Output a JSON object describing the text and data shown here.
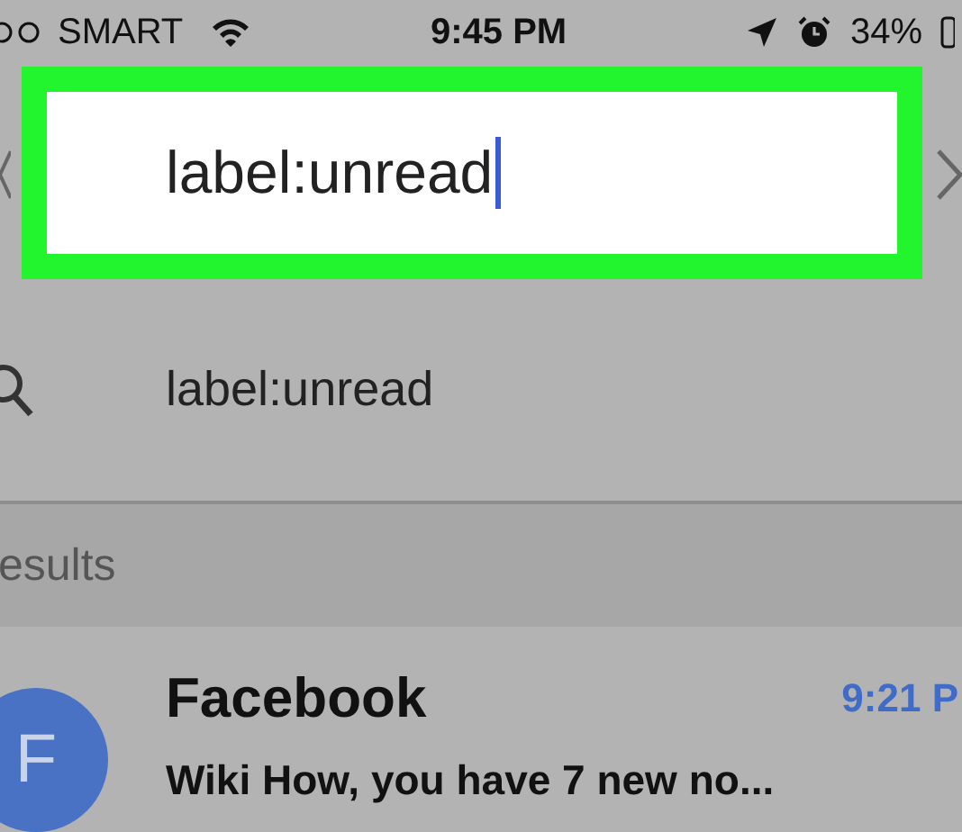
{
  "status_bar": {
    "carrier": "SMART",
    "time": "9:45 PM",
    "battery": "34%"
  },
  "search_field": {
    "value": "label:unread",
    "highlighted": true
  },
  "suggestions": [
    {
      "text": "label:unread"
    }
  ],
  "section_header": {
    "title": "esults"
  },
  "emails": [
    {
      "avatar": "F",
      "sender": "Facebook",
      "time": "9:21 P",
      "snippet": "Wiki How, you have 7 new no...",
      "unread": true
    }
  ]
}
